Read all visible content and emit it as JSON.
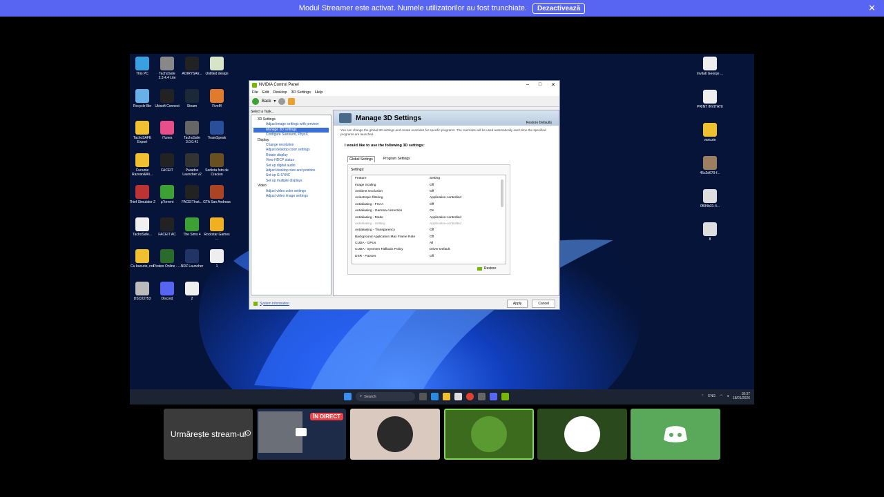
{
  "banner": {
    "message": "Modul Streamer este activat. Numele utilizatorilor au fost trunchiate.",
    "disable_label": "Dezactivează",
    "close_icon": "x-icon"
  },
  "desktop": {
    "left_icons": [
      {
        "label": "This PC",
        "color": "#3aa0e0"
      },
      {
        "label": "TachoSafe 2.3.4.4 Lite",
        "color": "#888888"
      },
      {
        "label": "AOIRYSAIr...",
        "color": "#222222"
      },
      {
        "label": "Untitled design",
        "color": "#d8e4c8"
      },
      {
        "label": "Recycle Bin",
        "color": "#6ab0e8"
      },
      {
        "label": "Ubisoft Connect",
        "color": "#222222"
      },
      {
        "label": "Steam",
        "color": "#1b2838"
      },
      {
        "label": "FiveM",
        "color": "#e07b2b"
      },
      {
        "label": "TachoSAFE Export",
        "color": "#f0c030"
      },
      {
        "label": "iTunes",
        "color": "#e84f8a"
      },
      {
        "label": "TachoSafe 3.0.0.41",
        "color": "#666666"
      },
      {
        "label": "TeamSpeak",
        "color": "#2a4f9a"
      },
      {
        "label": "Cununie Razvan&Ali...",
        "color": "#f0c030"
      },
      {
        "label": "FACEIT",
        "color": "#222222"
      },
      {
        "label": "Paradox Launcher v2",
        "color": "#333333"
      },
      {
        "label": "Sedinta foto de Craciun",
        "color": "#6a5020"
      },
      {
        "label": "Thief Simulator 2",
        "color": "#bb3333"
      },
      {
        "label": "µTorrent",
        "color": "#3ca035"
      },
      {
        "label": "FACEITInst...",
        "color": "#222222"
      },
      {
        "label": "GTA San Andreas",
        "color": "#aa4422"
      },
      {
        "label": "TachoSafe...",
        "color": "#f0f0f0"
      },
      {
        "label": "FACEIT AC",
        "color": "#222222"
      },
      {
        "label": "The Sims 4",
        "color": "#3ca035"
      },
      {
        "label": "Rockstar Games ...",
        "color": "#f0b020"
      },
      {
        "label": "Cu bucurie, noi",
        "color": "#f0c030"
      },
      {
        "label": "Pirates Online - ...",
        "color": "#2a6a2a"
      },
      {
        "label": "NRZ Launcher",
        "color": "#223366"
      },
      {
        "label": "1",
        "color": "#eeeeee"
      },
      {
        "label": "DSC03753",
        "color": "#bbbbbb"
      },
      {
        "label": "Discord",
        "color": "#5865f2"
      },
      {
        "label": "2",
        "color": "#eeeeee"
      }
    ],
    "right_icons": [
      {
        "label": "Invitati George ...",
        "color": "#eeeeee"
      },
      {
        "label": "PRINT INVITATII",
        "color": "#eeeeee"
      },
      {
        "label": "vanuzie",
        "color": "#f0c030"
      },
      {
        "label": "45c2d679-f...",
        "color": "#9a8060"
      },
      {
        "label": "0f6f4b31-4...",
        "color": "#dddddd"
      },
      {
        "label": "8",
        "color": "#dddddd"
      }
    ]
  },
  "nvidia": {
    "title": "NVIDIA Control Panel",
    "menu": [
      "File",
      "Edit",
      "Desktop",
      "3D Settings",
      "Help"
    ],
    "back_label": "Back",
    "select_task": "Select a Task...",
    "tree": [
      {
        "label": "3D Settings",
        "level": 1
      },
      {
        "label": "Adjust image settings with preview",
        "level": 2
      },
      {
        "label": "Manage 3D settings",
        "level": 2,
        "selected": true
      },
      {
        "label": "Configure Surround, PhysX",
        "level": 2
      },
      {
        "label": "Display",
        "level": 1
      },
      {
        "label": "Change resolution",
        "level": 2
      },
      {
        "label": "Adjust desktop color settings",
        "level": 2
      },
      {
        "label": "Rotate display",
        "level": 2
      },
      {
        "label": "View HDCP status",
        "level": 2
      },
      {
        "label": "Set up digital audio",
        "level": 2
      },
      {
        "label": "Adjust desktop size and position",
        "level": 2
      },
      {
        "label": "Set up G-SYNC",
        "level": 2
      },
      {
        "label": "Set up multiple displays",
        "level": 2
      },
      {
        "label": "Video",
        "level": 1
      },
      {
        "label": "Adjust video color settings",
        "level": 2
      },
      {
        "label": "Adjust video image settings",
        "level": 2
      }
    ],
    "panel_title": "Manage 3D Settings",
    "restore_defaults": "Restore Defaults",
    "description": "You can change the global 3D settings and create overrides for specific programs. The overrides will be used automatically each time the specified programs are launched.",
    "lead": "I would like to use the following 3D settings:",
    "tabs": [
      "Global Settings",
      "Program Settings"
    ],
    "settings_label": "Settings:",
    "columns": [
      "Feature",
      "Setting"
    ],
    "rows": [
      {
        "feature": "Image Scaling",
        "setting": "Off"
      },
      {
        "feature": "Ambient Occlusion",
        "setting": "Off"
      },
      {
        "feature": "Anisotropic filtering",
        "setting": "Application-controlled"
      },
      {
        "feature": "Antialiasing - FXAA",
        "setting": "Off"
      },
      {
        "feature": "Antialiasing - Gamma correction",
        "setting": "On"
      },
      {
        "feature": "Antialiasing - Mode",
        "setting": "Application-controlled"
      },
      {
        "feature": "Antialiasing - Setting",
        "setting": "Application-controlled",
        "dim": true
      },
      {
        "feature": "Antialiasing - Transparency",
        "setting": "Off"
      },
      {
        "feature": "Background Application Max Frame Rate",
        "setting": "Off"
      },
      {
        "feature": "CUDA - GPUs",
        "setting": "All"
      },
      {
        "feature": "CUDA - Sysmem Fallback Policy",
        "setting": "Driver Default"
      },
      {
        "feature": "DSR - Factors",
        "setting": "Off"
      }
    ],
    "restore": "Restore",
    "system_info": "System Information",
    "apply": "Apply",
    "cancel": "Cancel"
  },
  "taskbar": {
    "search": "Search",
    "lang": "ENG",
    "time": "18:37",
    "date": "18/01/2026"
  },
  "tiles": {
    "watch_stream": "Urmărește stream-ul",
    "live_badge": "ÎN DIRECT"
  }
}
